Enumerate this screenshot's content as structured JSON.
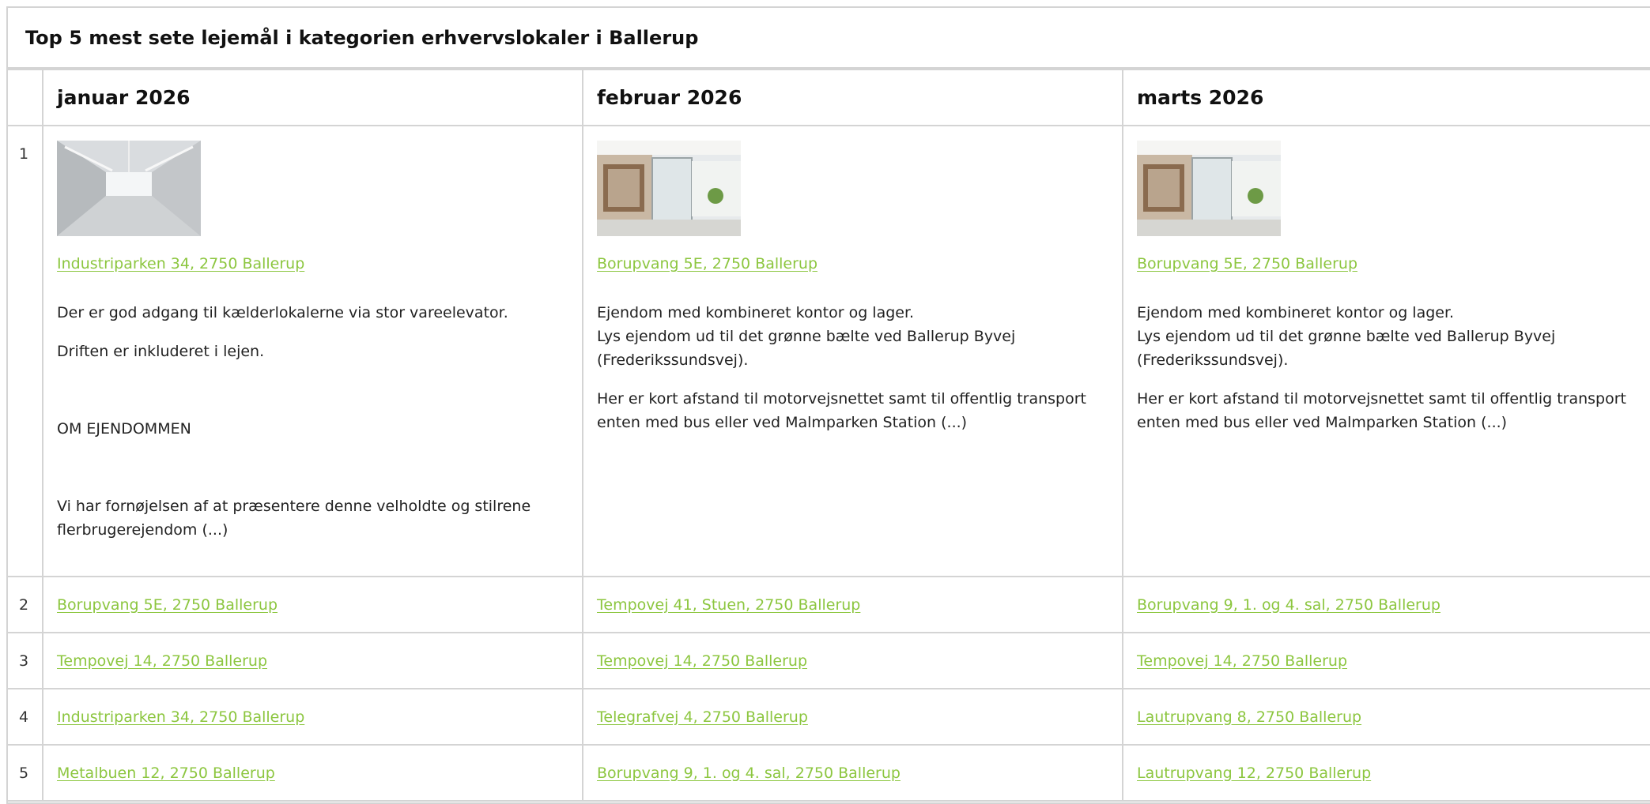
{
  "title": "Top 5 mest sete lejemål i kategorien erhvervslokaler i Ballerup",
  "colors": {
    "link": "#8cc63f",
    "border": "#d4d4d4"
  },
  "months": [
    "januar 2026",
    "februar 2026",
    "marts 2026"
  ],
  "rows": [
    {
      "rank": "1",
      "cells": [
        {
          "image": "warehouse-interior-photo",
          "link": "Industriparken 34, 2750 Ballerup",
          "desc": [
            "Der er god adgang til kælderlokalerne via stor vareelevator.",
            "Driften er inkluderet i lejen.",
            "OM EJENDOMMEN",
            "Vi har fornøjelsen af at præsentere denne velholdte og stilrene flerbrugerejendom (...)"
          ]
        },
        {
          "image": "office-interior-photo",
          "link": "Borupvang 5E, 2750 Ballerup",
          "desc": [
            "Ejendom med kombineret kontor og lager.",
            "Lys ejendom ud til det grønne bælte ved Ballerup Byvej (Frederikssundsvej).",
            "Her er kort afstand til motorvejsnettet samt til offentlig transport enten med bus eller ved Malmparken Station (...)"
          ]
        },
        {
          "image": "office-interior-photo",
          "link": "Borupvang 5E, 2750 Ballerup",
          "desc": [
            "Ejendom med kombineret kontor og lager.",
            "Lys ejendom ud til det grønne bælte ved Ballerup Byvej (Frederikssundsvej).",
            "Her er kort afstand til motorvejsnettet samt til offentlig transport enten med bus eller ved Malmparken Station (...)"
          ]
        }
      ]
    },
    {
      "rank": "2",
      "links": [
        "Borupvang 5E, 2750 Ballerup",
        "Tempovej 41, Stuen, 2750 Ballerup",
        "Borupvang 9, 1. og 4. sal, 2750 Ballerup"
      ]
    },
    {
      "rank": "3",
      "links": [
        "Tempovej 14, 2750 Ballerup",
        "Tempovej 14, 2750 Ballerup",
        "Tempovej 14, 2750 Ballerup"
      ]
    },
    {
      "rank": "4",
      "links": [
        "Industriparken 34, 2750 Ballerup",
        "Telegrafvej 4, 2750 Ballerup",
        "Lautrupvang 8, 2750 Ballerup"
      ]
    },
    {
      "rank": "5",
      "links": [
        "Metalbuen 12, 2750 Ballerup",
        "Borupvang 9, 1. og 4. sal, 2750 Ballerup",
        "Lautrupvang 12, 2750 Ballerup"
      ]
    }
  ]
}
